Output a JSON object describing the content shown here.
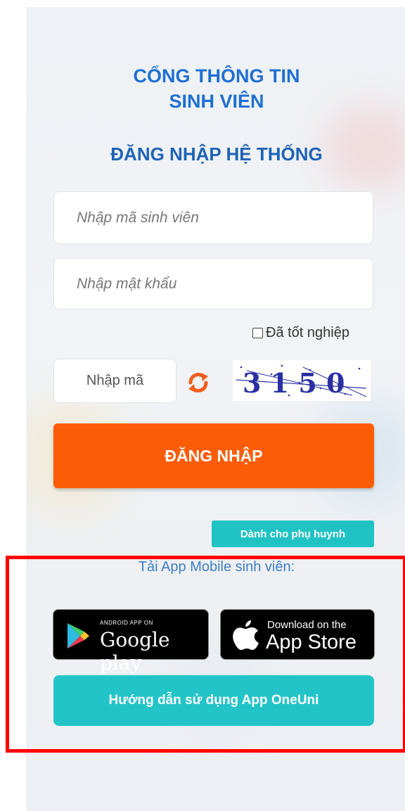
{
  "portal_title_line1": "CỔNG THÔNG TIN",
  "portal_title_line2": "SINH VIÊN",
  "login_heading": "ĐĂNG NHẬP HỆ THỐNG",
  "student_id_placeholder": "Nhập mã sinh viên",
  "password_placeholder": "Nhập mật khẩu",
  "graduated_label": "Đã tốt nghiệp",
  "captcha_placeholder": "Nhập mã",
  "captcha_text": "3 1 5 0",
  "login_button": "ĐĂNG NHẬP",
  "parent_button": "Dành cho phụ huynh",
  "app_section_label": "Tải App Mobile sinh viên:",
  "google_play": {
    "small": "ANDROID APP ON",
    "large": "Google play"
  },
  "app_store": {
    "small": "Download on the",
    "large": "App Store"
  },
  "guide_button": "Hướng dẫn sử dụng App OneUni",
  "colors": {
    "title": "#1f6fd1",
    "login_button": "#fd5c07",
    "teal": "#20c3c4",
    "highlight_frame": "#ff0000"
  },
  "icons": [
    "refresh-icon",
    "google-play-icon",
    "apple-icon"
  ]
}
